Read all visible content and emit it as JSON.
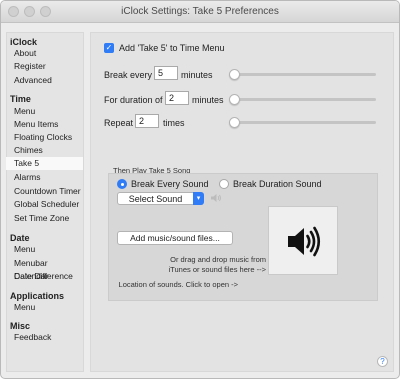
{
  "window": {
    "title": "iClock Settings: Take 5 Preferences"
  },
  "sidebar": {
    "sections": [
      {
        "heading": "iClock",
        "items": [
          "About",
          "Register",
          "Advanced"
        ]
      },
      {
        "heading": "Time",
        "items": [
          "Menu",
          "Menu Items",
          "Floating Clocks",
          "Chimes",
          "Take 5",
          "Alarms",
          "Countdown Timer",
          "Global Scheduler",
          "Set Time Zone"
        ]
      },
      {
        "heading": "Date",
        "items": [
          "Menu",
          "Menubar Calendar",
          "Date Difference"
        ]
      },
      {
        "heading": "Applications",
        "items": [
          "Menu"
        ]
      },
      {
        "heading": "Misc",
        "items": [
          "Feedback"
        ]
      }
    ],
    "selected": "Take 5"
  },
  "take5": {
    "add_to_menu_label": "Add 'Take 5' to Time Menu",
    "add_to_menu_checked": true,
    "break_every": {
      "label": "Break every",
      "value": "5",
      "unit": "minutes",
      "slider_fraction": 0.0
    },
    "duration": {
      "label": "For duration of",
      "value": "2",
      "unit": "minutes",
      "slider_fraction": 0.0
    },
    "repeat": {
      "label": "Repeat",
      "value": "2",
      "unit": "times",
      "slider_fraction": 0.0
    }
  },
  "song": {
    "caption": "Then Play Take 5 Song",
    "radio_every": "Break Every Sound",
    "radio_duration": "Break Duration Sound",
    "selected_radio": "Break Every Sound",
    "select_value": "Select Sound",
    "add_button": "Add music/sound files...",
    "drag_line1": "Or drag and drop music from",
    "drag_line2": "iTunes or sound files here -->",
    "location_text": "Location of sounds. Click to open ->"
  },
  "icons": {
    "small_speaker": "speaker-icon",
    "big_speaker": "speaker-loud-icon",
    "help": "help-icon"
  },
  "colors": {
    "accent": "#2f7cf6"
  }
}
